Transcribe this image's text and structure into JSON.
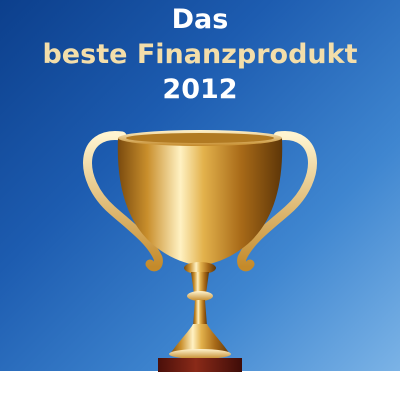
{
  "headline": {
    "line1": "Das",
    "line2": "beste Finanzprodukt",
    "line3": "2012"
  },
  "colors": {
    "line1": "#ffffff",
    "line2": "#f3deaa",
    "line3": "#ffffff",
    "background_dark": "#0c3f8c",
    "background_light": "#7bb3e6",
    "gold": "#d9a63a",
    "base": "#7a1f14"
  },
  "icons": {
    "trophy": "trophy-icon"
  }
}
